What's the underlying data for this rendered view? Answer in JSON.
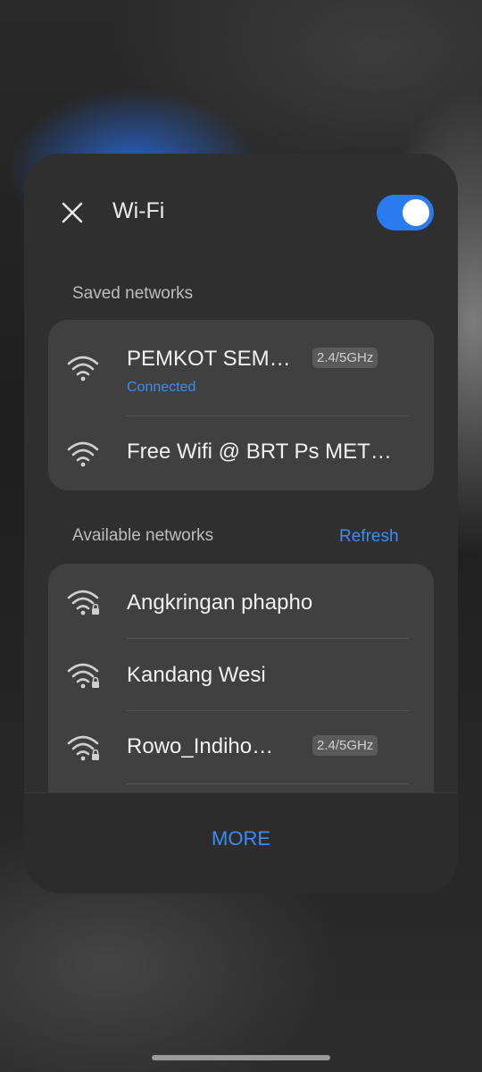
{
  "header": {
    "title": "Wi-Fi",
    "toggle_on": true
  },
  "saved": {
    "label": "Saved networks",
    "items": [
      {
        "name": "PEMKOT SEM…",
        "status": "Connected",
        "band": "2.4/5GHz",
        "icon": "wifi-icon"
      },
      {
        "name": "Free Wifi @ BRT Ps MET…",
        "icon": "wifi-icon"
      }
    ]
  },
  "available": {
    "label": "Available networks",
    "refresh_label": "Refresh",
    "items": [
      {
        "name": "Angkringan phapho",
        "icon": "wifi-lock-icon"
      },
      {
        "name": "Kandang Wesi",
        "icon": "wifi-lock-icon"
      },
      {
        "name": "Rowo_Indiho…",
        "band": "2.4/5GHz",
        "icon": "wifi-lock-icon"
      }
    ]
  },
  "footer": {
    "more_label": "MORE"
  },
  "colors": {
    "accent": "#3b8cf5",
    "toggle": "#2a7bf0",
    "panel": "#2f2f2f",
    "card": "#404040"
  }
}
